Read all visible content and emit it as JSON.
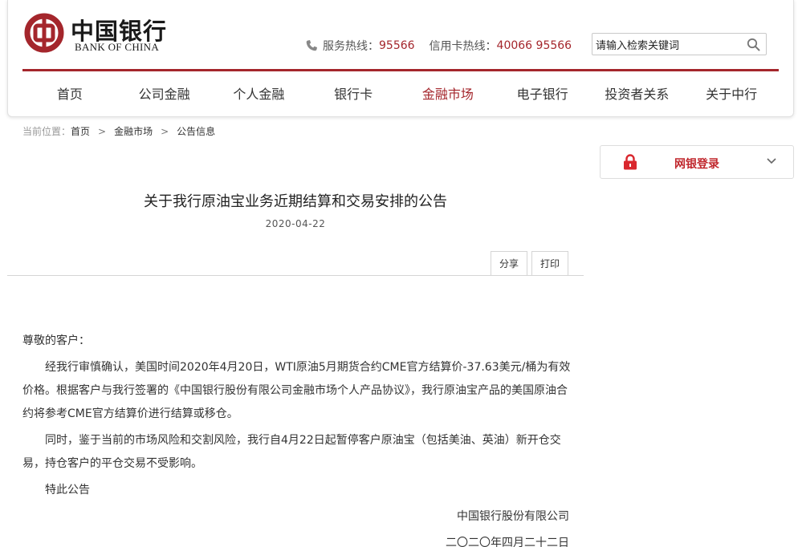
{
  "brand": {
    "name_cn": "中国银行",
    "name_en": "BANK OF CHINA",
    "accent": "#a4262c"
  },
  "header": {
    "service_label": "服务热线：",
    "service_number": "95566",
    "card_label": "信用卡热线：",
    "card_number": "40066 95566",
    "phone_icon": "phone-icon"
  },
  "search": {
    "value": "请输入检索关键词",
    "icon": "search-icon"
  },
  "nav": {
    "items": [
      {
        "label": "首页"
      },
      {
        "label": "公司金融"
      },
      {
        "label": "个人金融"
      },
      {
        "label": "银行卡"
      },
      {
        "label": "金融市场"
      },
      {
        "label": "电子银行"
      },
      {
        "label": "投资者关系"
      },
      {
        "label": "关于中行"
      }
    ],
    "active": "金融市场"
  },
  "breadcrumb": {
    "prefix": "当前位置：",
    "items": [
      "首页",
      "金融市场",
      "公告信息"
    ]
  },
  "article": {
    "title": "关于我行原油宝业务近期结算和交易安排的公告",
    "date": "2020-04-22",
    "share_label": "分享",
    "print_label": "打印",
    "salutation": "尊敬的客户：",
    "para1": "经我行审慎确认，美国时间2020年4月20日，WTI原油5月期货合约CME官方结算价-37.63美元/桶为有效价格。根据客户与我行签署的《中国银行股份有限公司金融市场个人产品协议》，我行原油宝产品的美国原油合约将参考CME官方结算价进行结算或移仓。",
    "para2": "同时，鉴于当前的市场风险和交割风险，我行自4月22日起暂停客户原油宝（包括美油、英油）新开仓交易，持仓客户的平仓交易不受影响。",
    "closing": "特此公告",
    "signature": "中国银行股份有限公司",
    "sign_date": "二〇二〇年四月二十二日"
  },
  "sidebar": {
    "login_label": "网银登录",
    "lock_icon": "lock-icon",
    "chevron_icon": "chevron-down-icon"
  }
}
